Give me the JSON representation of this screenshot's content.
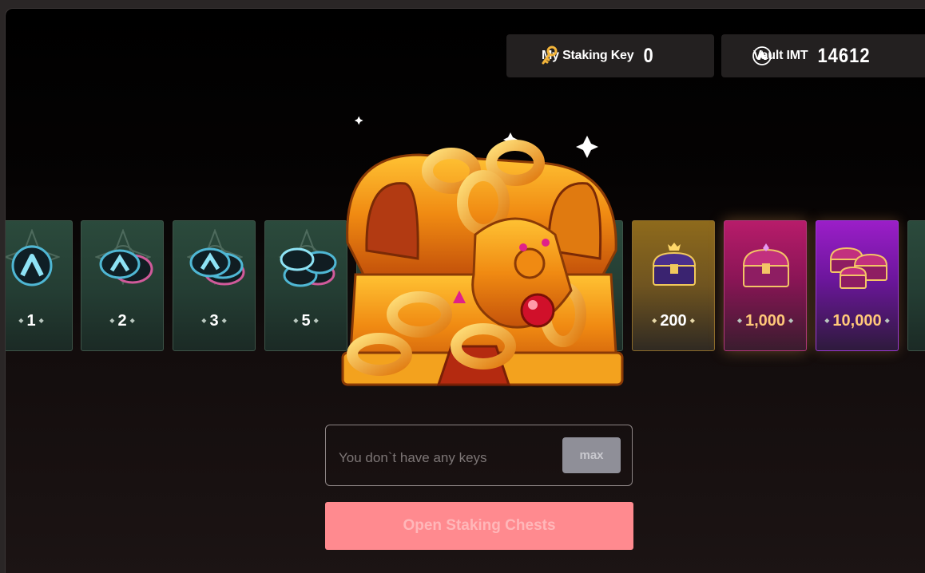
{
  "stats": {
    "key_label": "My Staking Key",
    "key_value": "0",
    "vault_label": "Vault IMT",
    "vault_value": "14612"
  },
  "reward_cards": [
    {
      "amount": "1",
      "icon": "single-coin-icon",
      "theme": "green"
    },
    {
      "amount": "2",
      "icon": "coin-pair-icon",
      "theme": "green"
    },
    {
      "amount": "3",
      "icon": "coin-stack-icon",
      "theme": "green"
    },
    {
      "amount": "5",
      "icon": "coin-pile-icon",
      "theme": "green"
    },
    {
      "amount": "200",
      "icon": "purple-chest-icon",
      "theme": "gold"
    },
    {
      "amount": "1,000",
      "icon": "pink-chest-icon",
      "theme": "pink"
    },
    {
      "amount": "10,000",
      "icon": "chest-pile-icon",
      "theme": "purple"
    }
  ],
  "key_input": {
    "placeholder": "You don`t have any keys",
    "max_label": "max"
  },
  "open_button_label": "Open Staking Chests",
  "colors": {
    "open_button": "#ff8a8f",
    "card_green": "#2b4a3c",
    "card_gold": "#8e6a1c",
    "card_pink": "#b71c6a",
    "card_purple": "#9b1ec8",
    "rare_amount": "#ffc879"
  }
}
